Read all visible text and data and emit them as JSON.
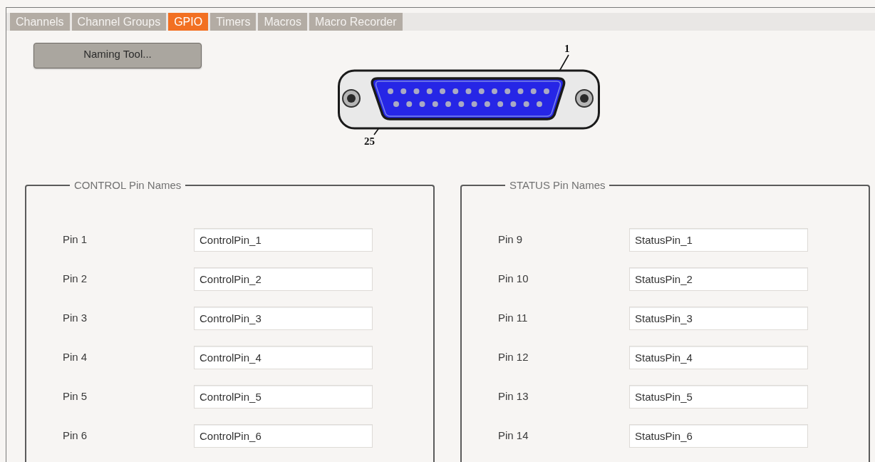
{
  "tabs": [
    {
      "label": "Channels",
      "selected": false
    },
    {
      "label": "Channel Groups",
      "selected": false
    },
    {
      "label": "GPIO",
      "selected": true
    },
    {
      "label": "Timers",
      "selected": false
    },
    {
      "label": "Macros",
      "selected": false
    },
    {
      "label": "Macro Recorder",
      "selected": false
    }
  ],
  "naming_tool_button": {
    "label": "Naming Tool..."
  },
  "connector": {
    "top_pin_label": "1",
    "bottom_pin_label": "25"
  },
  "groups": [
    {
      "title": "CONTROL Pin Names",
      "pins": [
        {
          "label": "Pin 1",
          "value": "ControlPin_1"
        },
        {
          "label": "Pin 2",
          "value": "ControlPin_2"
        },
        {
          "label": "Pin 3",
          "value": "ControlPin_3"
        },
        {
          "label": "Pin 4",
          "value": "ControlPin_4"
        },
        {
          "label": "Pin 5",
          "value": "ControlPin_5"
        },
        {
          "label": "Pin 6",
          "value": "ControlPin_6"
        }
      ]
    },
    {
      "title": "STATUS Pin Names",
      "pins": [
        {
          "label": "Pin 9",
          "value": "StatusPin_1"
        },
        {
          "label": "Pin 10",
          "value": "StatusPin_2"
        },
        {
          "label": "Pin 11",
          "value": "StatusPin_3"
        },
        {
          "label": "Pin 12",
          "value": "StatusPin_4"
        },
        {
          "label": "Pin 13",
          "value": "StatusPin_5"
        },
        {
          "label": "Pin 14",
          "value": "StatusPin_6"
        }
      ]
    }
  ]
}
